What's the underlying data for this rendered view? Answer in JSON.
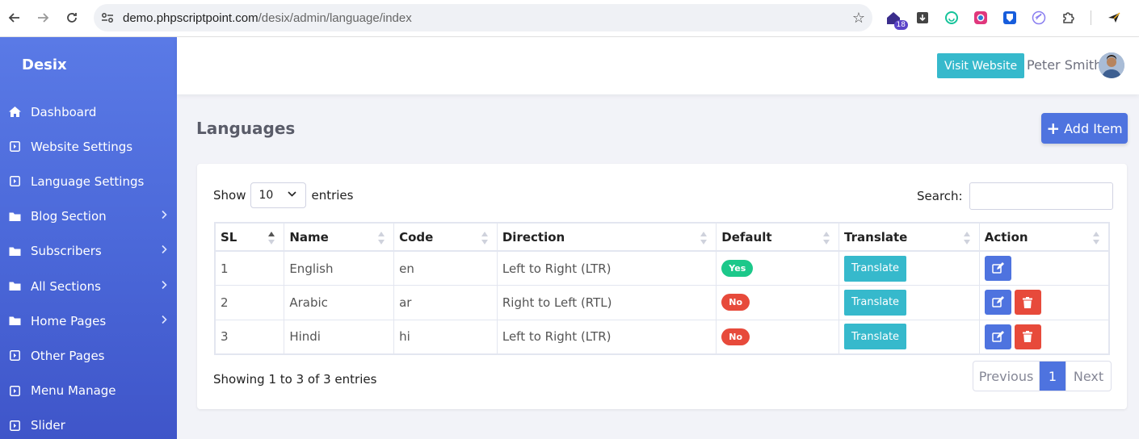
{
  "browser": {
    "url_domain": "demo.phpscriptpoint.com",
    "url_path": "/desix/admin/language/index",
    "ext_badge": "18"
  },
  "sidebar": {
    "brand": "Desix",
    "items": [
      {
        "label": "Dashboard",
        "icon": "home-icon",
        "has_children": false
      },
      {
        "label": "Website Settings",
        "icon": "square-arrow-icon",
        "has_children": false
      },
      {
        "label": "Language Settings",
        "icon": "square-arrow-icon",
        "has_children": false
      },
      {
        "label": "Blog Section",
        "icon": "folder-icon",
        "has_children": true
      },
      {
        "label": "Subscribers",
        "icon": "folder-icon",
        "has_children": true
      },
      {
        "label": "All Sections",
        "icon": "folder-icon",
        "has_children": true
      },
      {
        "label": "Home Pages",
        "icon": "folder-icon",
        "has_children": true
      },
      {
        "label": "Other Pages",
        "icon": "square-arrow-icon",
        "has_children": false
      },
      {
        "label": "Menu Manage",
        "icon": "square-arrow-icon",
        "has_children": false
      },
      {
        "label": "Slider",
        "icon": "square-arrow-icon",
        "has_children": false
      }
    ]
  },
  "topbar": {
    "visit_label": "Visit Website",
    "user_name": "Peter Smith"
  },
  "main": {
    "title": "Languages",
    "add_label": "Add Item",
    "show_label": "Show",
    "entries_label": "entries",
    "page_length": "10",
    "search_label": "Search:",
    "search_value": "",
    "columns": [
      "SL",
      "Name",
      "Code",
      "Direction",
      "Default",
      "Translate",
      "Action"
    ],
    "rows": [
      {
        "sl": "1",
        "name": "English",
        "code": "en",
        "direction": "Left to Right (LTR)",
        "default": "Yes",
        "translate": "Translate",
        "deletable": false
      },
      {
        "sl": "2",
        "name": "Arabic",
        "code": "ar",
        "direction": "Right to Left (RTL)",
        "default": "No",
        "translate": "Translate",
        "deletable": true
      },
      {
        "sl": "3",
        "name": "Hindi",
        "code": "hi",
        "direction": "Left to Right (LTR)",
        "default": "No",
        "translate": "Translate",
        "deletable": true
      }
    ],
    "info": "Showing 1 to 3 of 3 entries",
    "pagination": {
      "prev": "Previous",
      "current": "1",
      "next": "Next"
    }
  },
  "colors": {
    "sidebar": "#4e73df",
    "primary": "#4e73df",
    "info": "#36b9cc",
    "success": "#1cc88a",
    "danger": "#e74a3b"
  }
}
